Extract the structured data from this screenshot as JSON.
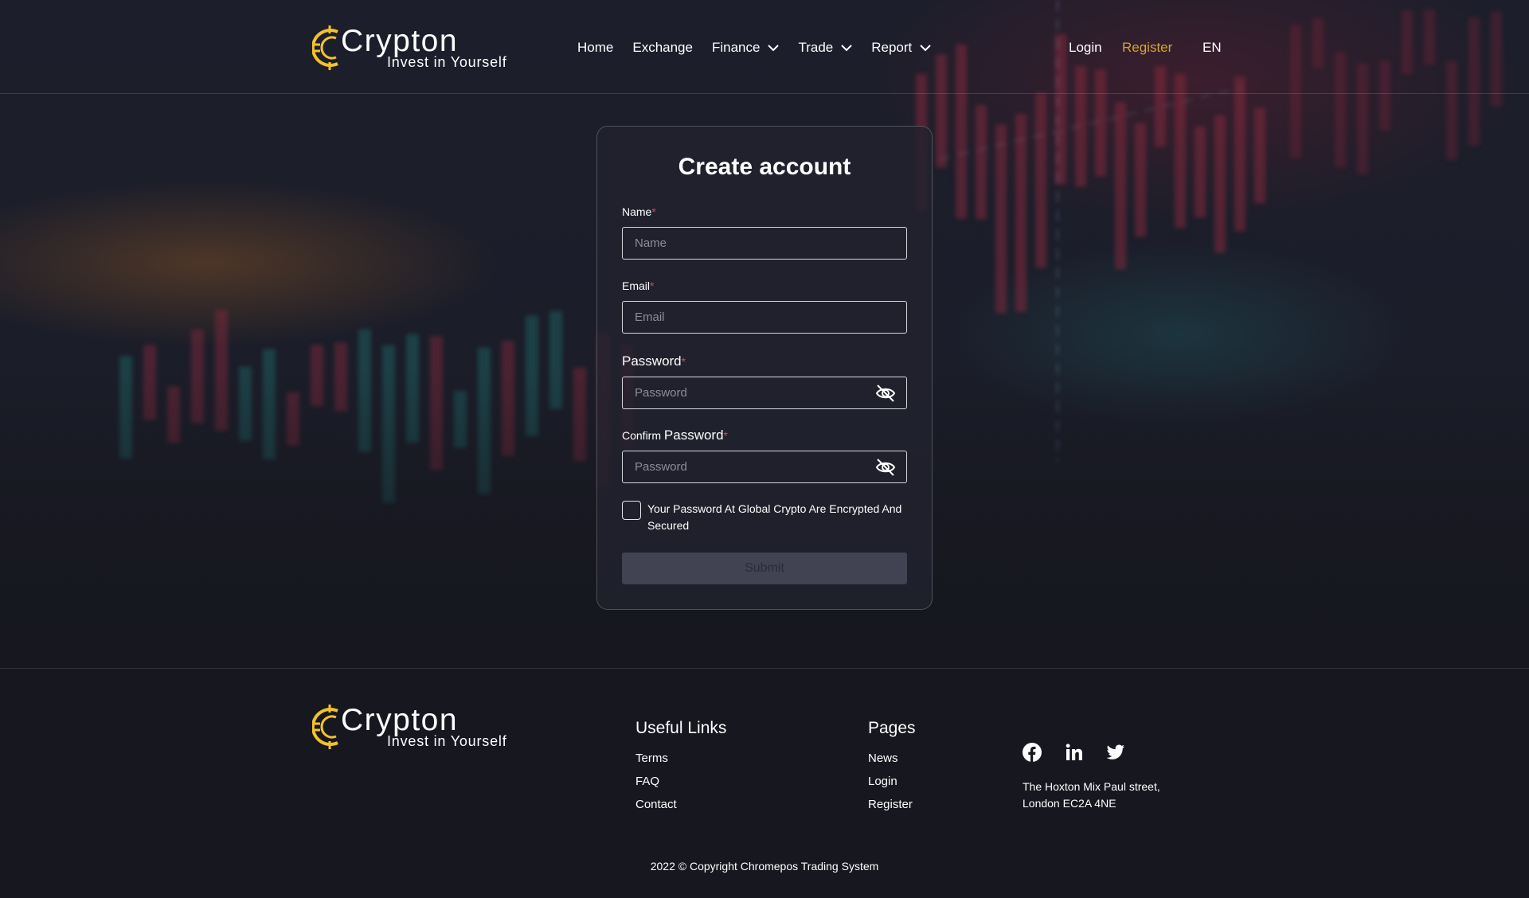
{
  "brand": {
    "name": "Crypton",
    "tagline": "Invest in Yourself",
    "accent_color": "#f3c22a"
  },
  "header": {
    "nav": [
      {
        "label": "Home"
      },
      {
        "label": "Exchange"
      },
      {
        "label": "Finance",
        "icon": "chevron-down-icon"
      },
      {
        "label": "Trade",
        "icon": "chevron-down-icon"
      },
      {
        "label": "Report",
        "icon": "chevron-down-icon"
      }
    ],
    "login": "Login",
    "register": "Register",
    "language": "EN"
  },
  "form": {
    "title": "Create account",
    "name_label": "Name",
    "name_placeholder": "Name",
    "email_label": "Email",
    "email_placeholder": "Email",
    "password_label": "Password",
    "password_placeholder": "Password",
    "confirm_label_prefix": "Confirm",
    "confirm_label_word": "Password",
    "confirm_placeholder": "Password",
    "required_mark": "*",
    "checkbox_text": "Your Password At Global Crypto Are Encrypted And Secured",
    "checkbox_checked": false,
    "submit": "Submit"
  },
  "footer": {
    "useful_links_title": "Useful Links",
    "useful_links": [
      "Terms",
      "FAQ",
      "Contact"
    ],
    "pages_title": "Pages",
    "pages": [
      "News",
      "Login",
      "Register"
    ],
    "social_icons": [
      "facebook-icon",
      "linkedin-icon",
      "twitter-icon"
    ],
    "address_line1": "The Hoxton Mix Paul street,",
    "address_line2": "London EC2A 4NE",
    "copyright": "2022 © Copyright Chromepos Trading System"
  },
  "colors": {
    "background": "#16171f",
    "register_link": "#d4a62c",
    "required": "#e0435c",
    "submit_bg": "#414252"
  }
}
